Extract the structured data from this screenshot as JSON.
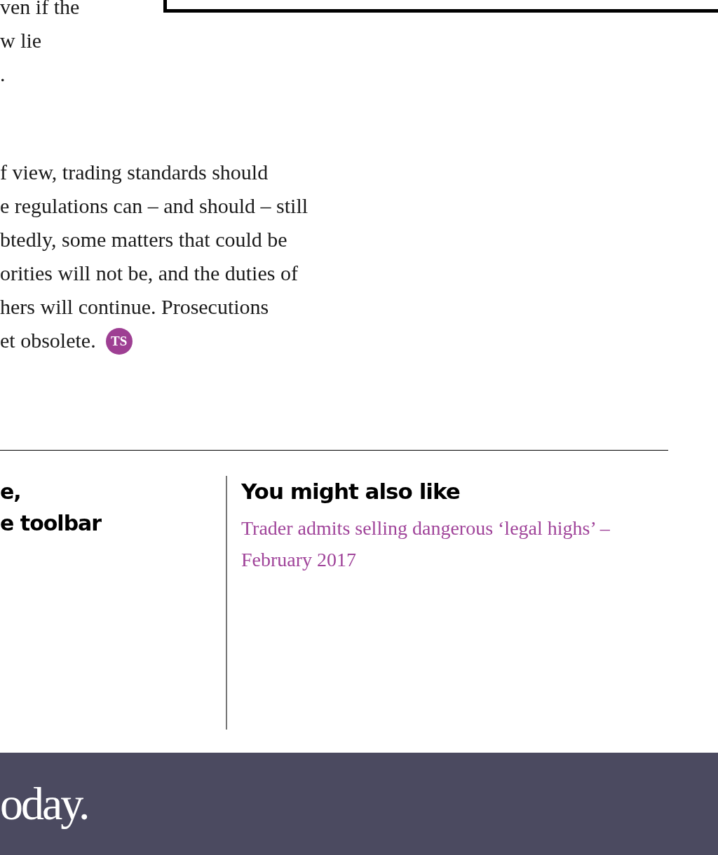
{
  "article": {
    "top_lines": [
      "ven if the",
      "w lie",
      "."
    ],
    "paragraph_lines": [
      "f view, trading standards should",
      "e regulations can – and should – still",
      "btedly, some matters that could be",
      "orities will not be, and the duties of",
      "hers will continue. Prosecutions",
      "et obsolete."
    ],
    "end_mark": "TS"
  },
  "promo": {
    "lines": [
      "e,",
      "e toolbar"
    ]
  },
  "related": {
    "heading": "You might also like",
    "links": [
      "Trader admits selling dangerous ‘legal highs’ – February 2017"
    ]
  },
  "footer": {
    "logo": "oday."
  }
}
